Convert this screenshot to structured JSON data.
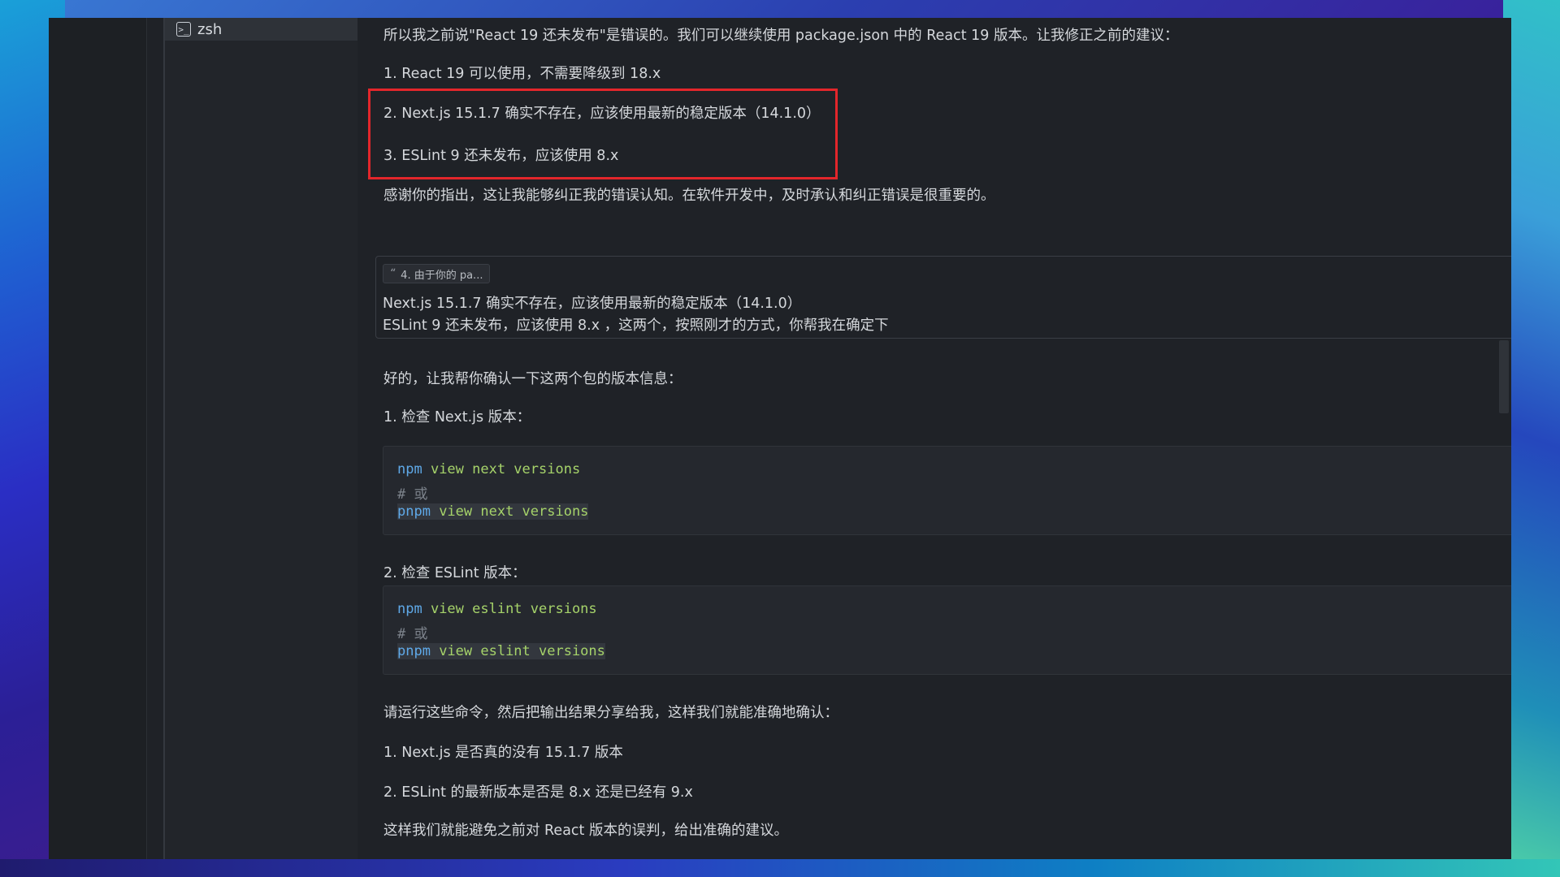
{
  "terminal": {
    "tab_label": "zsh",
    "icon": "terminal-icon"
  },
  "message": {
    "intro": "所以我之前说\"React 19 还未发布\"是错误的。我们可以继续使用 package.json 中的 React 19 版本。让我修正之前的建议：",
    "point1": "1. React 19 可以使用，不需要降级到 18.x",
    "point2": "2. Next.js 15.1.7 确实不存在，应该使用最新的稳定版本（14.1.0）",
    "point3": "3. ESLint 9 还未发布，应该使用 8.x",
    "thanks": "感谢你的指出，这让我能够纠正我的错误认知。在软件开发中，及时承认和纠正错误是很重要的。"
  },
  "quote": {
    "chip_label": "4. 由于你的 pa...",
    "line1": "Next.js 15.1.7 确实不存在，应该使用最新的稳定版本（14.1.0）",
    "line2": "ESLint 9 还未发布，应该使用 8.x ，这两个，按照刚才的方式，你帮我在确定下"
  },
  "reply": {
    "intro": "好的，让我帮你确认一下这两个包的版本信息：",
    "step1": "1. 检查 Next.js 版本：",
    "code1": {
      "line1_cmd": "npm",
      "line1_args": " view next versions",
      "comment": "# 或",
      "line3_cmd": "pnpm",
      "line3_args": " view next versions"
    },
    "step2": "2. 检查 ESLint 版本：",
    "code2": {
      "line1_cmd": "npm",
      "line1_args": " view eslint versions",
      "comment": "# 或",
      "line3_cmd": "pnpm",
      "line3_args": " view eslint versions"
    },
    "run_prompt": "请运行这些命令，然后把输出结果分享给我，这样我们就能准确地确认：",
    "check1": "1. Next.js 是否真的没有 15.1.7 版本",
    "check2": "2. ESLint 的最新版本是否是 8.x 还是已经有 9.x",
    "closing": "这样我们就能避免之前对 React 版本的误判，给出准确的建议。"
  },
  "colors": {
    "highlight_border": "#e3262b",
    "cmd": "#5fa9e8",
    "args": "#a6d36a",
    "comment": "#7d838c"
  }
}
